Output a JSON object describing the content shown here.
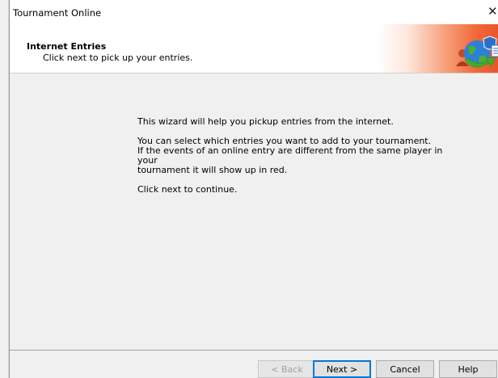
{
  "window": {
    "title": "Tournament Online",
    "close_glyph": "✕"
  },
  "header": {
    "title": "Internet Entries",
    "subtitle": "Click next to pick up your entries.",
    "icon": "globe-update-icon"
  },
  "content": {
    "para1": "This wizard will help you pickup entries from the internet.",
    "para2_line1": "You can select which entries you want to add to your tournament.",
    "para2_line2": "If the events of an online entry are different from the same player in your",
    "para2_line3": "tournament it will show up in red.",
    "para3": "Click next to continue."
  },
  "buttons": {
    "back": "< Back",
    "next": "Next >",
    "cancel": "Cancel",
    "help": "Help"
  },
  "colors": {
    "accent": "#0078d7",
    "header_gradient": "#e9552a"
  }
}
